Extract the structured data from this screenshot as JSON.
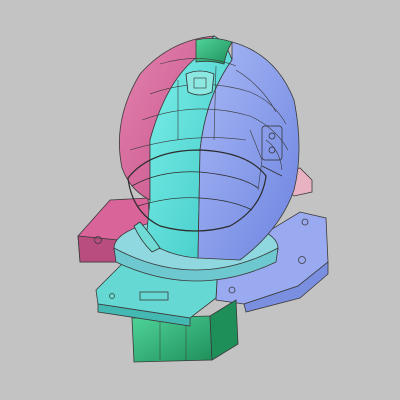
{
  "viewport": {
    "background": "#c3c3c3",
    "edge_color": "#3a3a3a",
    "parts": [
      {
        "name": "helmet-shell-left",
        "color": "#d96a9c"
      },
      {
        "name": "helmet-shell-center",
        "color": "#5fe0d8"
      },
      {
        "name": "helmet-shell-right",
        "color": "#8fa2ee"
      },
      {
        "name": "helmet-top-strip",
        "color": "#3fbf86"
      },
      {
        "name": "base-left-block",
        "color": "#d96a9c"
      },
      {
        "name": "base-front-plate",
        "color": "#66d8d4"
      },
      {
        "name": "base-right-block",
        "color": "#9aaaf0"
      },
      {
        "name": "base-support-column",
        "color": "#2fa66e"
      },
      {
        "name": "base-side-block",
        "color": "#e7b4c2"
      }
    ]
  }
}
